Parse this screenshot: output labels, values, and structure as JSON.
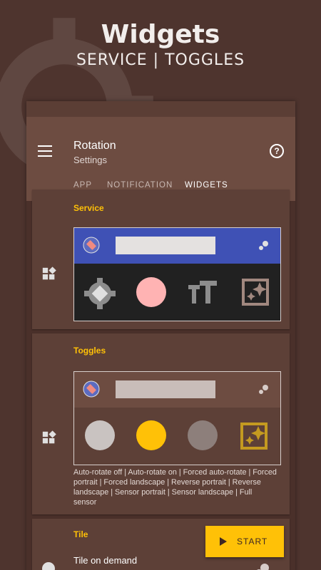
{
  "promo": {
    "title": "Widgets",
    "subtitle": "SERVICE | TOGGLES"
  },
  "appbar": {
    "title": "Rotation",
    "subtitle": "Settings",
    "menu_icon": "menu-icon",
    "help_icon": "help-icon"
  },
  "tabs": [
    {
      "label": "APP"
    },
    {
      "label": "NOTIFICATION"
    },
    {
      "label": "WIDGETS",
      "active": true
    }
  ],
  "cards": {
    "service": {
      "title": "Service",
      "header_color": "#3f51b5",
      "body_color": "#212121",
      "icons": [
        "auto-rotate-icon",
        "color-circle-icon",
        "text-size-icon",
        "wallpaper-icon"
      ]
    },
    "toggles": {
      "title": "Toggles",
      "header_color": "#6d4c41",
      "body_color": "#5d4037",
      "description": "Auto-rotate off | Auto-rotate on | Forced auto-rotate | Forced portrait | Forced landscape | Reverse portrait | Reverse landscape | Sensor portrait | Sensor landscape | Full sensor"
    },
    "tile": {
      "title": "Tile",
      "item_title": "Tile on demand"
    }
  },
  "start_button": {
    "label": "START"
  },
  "colors": {
    "accent": "#ffc107",
    "background": "#4e342e",
    "appbar": "#6d4c41",
    "card": "#5d4037"
  }
}
